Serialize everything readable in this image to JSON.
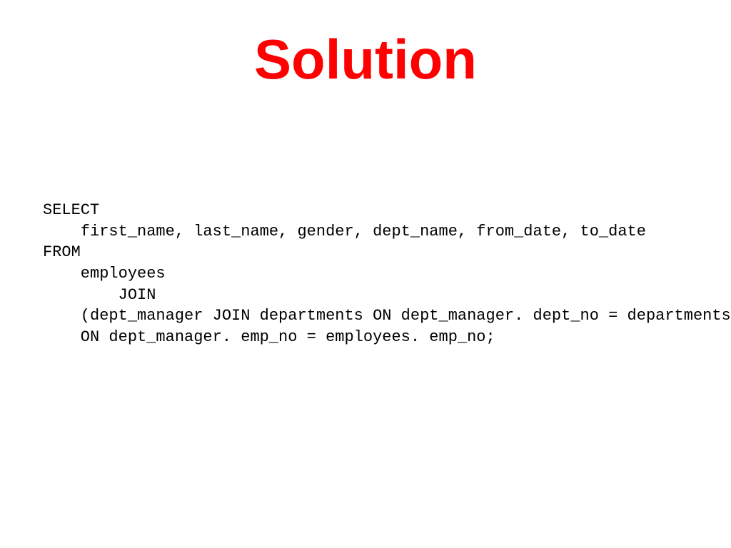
{
  "title": "Solution",
  "code": {
    "l1": "SELECT",
    "l2": "    first_name, last_name, gender, dept_name, from_date, to_date",
    "l3": "FROM",
    "l4": "    employees",
    "l5": "        JOIN",
    "l6": "    (dept_manager JOIN departments ON dept_manager. dept_no = departments. dept_no)",
    "l7": "    ON dept_manager. emp_no = employees. emp_no;"
  }
}
